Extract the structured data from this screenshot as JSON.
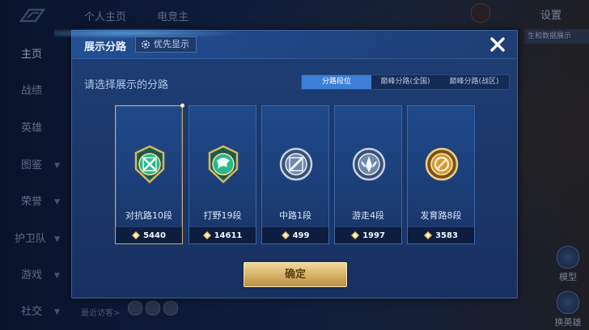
{
  "background": {
    "nav_items": [
      {
        "label": "主页",
        "active": true,
        "arrow": false
      },
      {
        "label": "战绩",
        "active": false,
        "arrow": false
      },
      {
        "label": "英雄",
        "active": false,
        "arrow": false
      },
      {
        "label": "图鉴",
        "active": false,
        "arrow": true
      },
      {
        "label": "荣誉",
        "active": false,
        "arrow": true
      },
      {
        "label": "护卫队",
        "active": false,
        "arrow": true
      },
      {
        "label": "游戏",
        "active": false,
        "arrow": true
      },
      {
        "label": "社交",
        "active": false,
        "arrow": true
      }
    ],
    "top_tabs": [
      "个人主页",
      "电竞主"
    ],
    "settings_label": "设置",
    "right_strip_text": "生和数据展示",
    "right_buttons": [
      "模型",
      "换英雄"
    ],
    "bottom_text": "最近访客>"
  },
  "modal": {
    "title": "展示分路",
    "priority_label": "优先显示",
    "subtitle": "请选择展示的分路",
    "segments": [
      {
        "label": "分路段位",
        "active": true
      },
      {
        "label": "巅峰分路(全国)",
        "active": false
      },
      {
        "label": "巅峰分路(战区)",
        "active": false
      }
    ],
    "cards": [
      {
        "label": "对抗路10段",
        "score": "5440",
        "badge": "sword-badge-icon",
        "selected": true,
        "color": "#3fd38a"
      },
      {
        "label": "打野19段",
        "score": "14611",
        "badge": "dragon-badge-icon",
        "selected": false,
        "color": "#3fd38a"
      },
      {
        "label": "中路1段",
        "score": "499",
        "badge": "staff-badge-icon",
        "selected": false,
        "color": "#9fb3cc"
      },
      {
        "label": "游走4段",
        "score": "1997",
        "badge": "wings-badge-icon",
        "selected": false,
        "color": "#9fb3cc"
      },
      {
        "label": "发育路8段",
        "score": "3583",
        "badge": "bow-badge-icon",
        "selected": false,
        "color": "#e0a93a"
      }
    ],
    "confirm_label": "确定"
  },
  "colors": {
    "accent": "#3d7fd6",
    "gold": "#d8b46b",
    "modal_bg": "#1e3f75"
  }
}
